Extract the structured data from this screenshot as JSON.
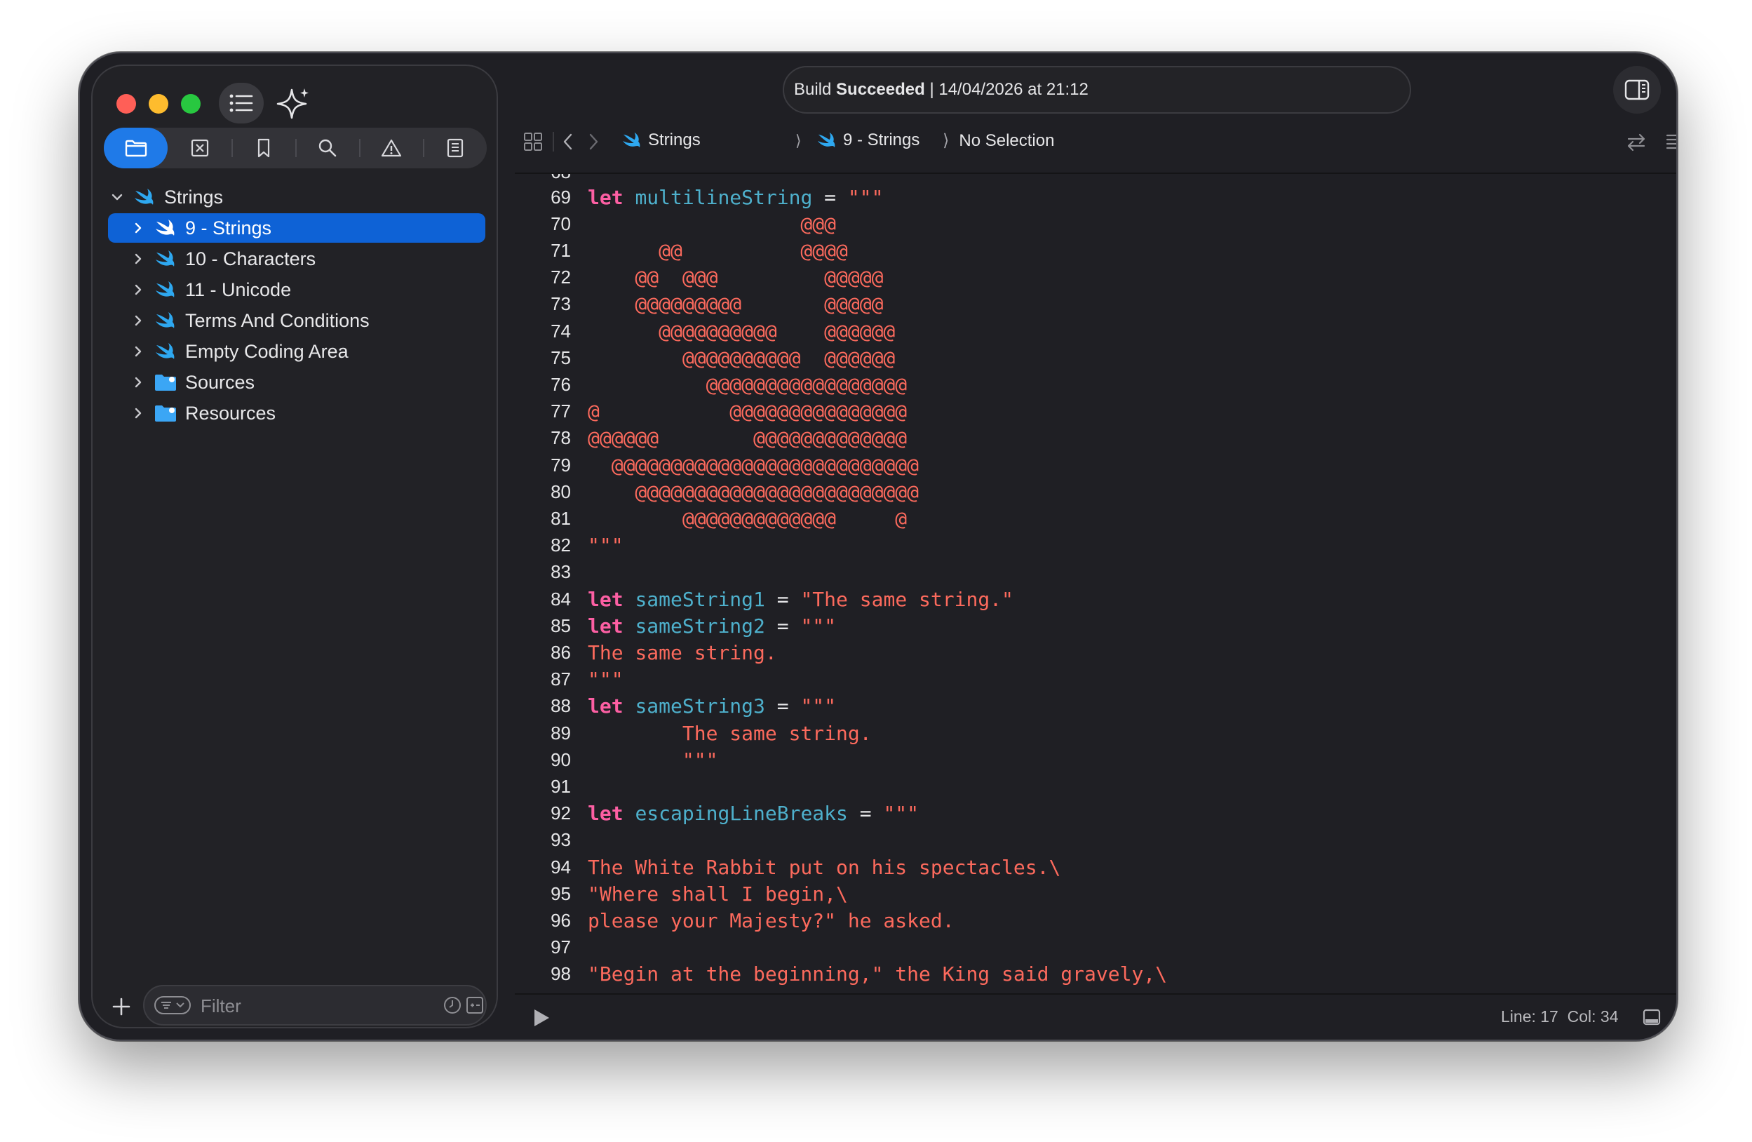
{
  "toolbar": {
    "build_prefix": "Build ",
    "build_state": "Succeeded",
    "build_time": " | 14/04/2026 at 21:12"
  },
  "navigator": {
    "tabs": [
      "folder-icon",
      "source-control-icon",
      "bookmark-icon",
      "search-icon",
      "warning-icon",
      "report-icon"
    ],
    "root": "Strings",
    "items": [
      {
        "label": "9 - Strings",
        "icon": "swift-icon",
        "selected": true
      },
      {
        "label": "10 - Characters",
        "icon": "swift-icon"
      },
      {
        "label": "11 - Unicode",
        "icon": "swift-icon"
      },
      {
        "label": "Terms And Conditions",
        "icon": "swift-icon"
      },
      {
        "label": "Empty Coding Area",
        "icon": "swift-icon"
      },
      {
        "label": "Sources",
        "icon": "folder-icon"
      },
      {
        "label": "Resources",
        "icon": "folder-icon"
      }
    ],
    "filter_placeholder": "Filter"
  },
  "jumpbar": {
    "crumb1": "Strings",
    "crumb2": "9 - Strings",
    "crumb3": "No Selection"
  },
  "code": {
    "lines": [
      {
        "n": "69",
        "t": [
          [
            "kw",
            "let"
          ],
          [
            "op",
            " "
          ],
          [
            "id",
            "multilineString"
          ],
          [
            "op",
            " = "
          ],
          [
            "str",
            "\"\"\""
          ]
        ]
      },
      {
        "n": "70",
        "t": [
          [
            "str",
            "                  @@@"
          ]
        ]
      },
      {
        "n": "71",
        "t": [
          [
            "str",
            "      @@          @@@@"
          ]
        ]
      },
      {
        "n": "72",
        "t": [
          [
            "str",
            "    @@  @@@         @@@@@"
          ]
        ]
      },
      {
        "n": "73",
        "t": [
          [
            "str",
            "    @@@@@@@@@       @@@@@"
          ]
        ]
      },
      {
        "n": "74",
        "t": [
          [
            "str",
            "      @@@@@@@@@@    @@@@@@"
          ]
        ]
      },
      {
        "n": "75",
        "t": [
          [
            "str",
            "        @@@@@@@@@@  @@@@@@"
          ]
        ]
      },
      {
        "n": "76",
        "t": [
          [
            "str",
            "          @@@@@@@@@@@@@@@@@"
          ]
        ]
      },
      {
        "n": "77",
        "t": [
          [
            "str",
            "@           @@@@@@@@@@@@@@@"
          ]
        ]
      },
      {
        "n": "78",
        "t": [
          [
            "str",
            "@@@@@@        @@@@@@@@@@@@@"
          ]
        ]
      },
      {
        "n": "79",
        "t": [
          [
            "str",
            "  @@@@@@@@@@@@@@@@@@@@@@@@@@"
          ]
        ]
      },
      {
        "n": "80",
        "t": [
          [
            "str",
            "    @@@@@@@@@@@@@@@@@@@@@@@@"
          ]
        ]
      },
      {
        "n": "81",
        "t": [
          [
            "str",
            "        @@@@@@@@@@@@@     @"
          ]
        ]
      },
      {
        "n": "82",
        "t": [
          [
            "str",
            "\"\"\""
          ]
        ]
      },
      {
        "n": "83",
        "t": []
      },
      {
        "n": "84",
        "t": [
          [
            "kw",
            "let"
          ],
          [
            "op",
            " "
          ],
          [
            "id",
            "sameString1"
          ],
          [
            "op",
            " = "
          ],
          [
            "str",
            "\"The same string.\""
          ]
        ]
      },
      {
        "n": "85",
        "t": [
          [
            "kw",
            "let"
          ],
          [
            "op",
            " "
          ],
          [
            "id",
            "sameString2"
          ],
          [
            "op",
            " = "
          ],
          [
            "str",
            "\"\"\""
          ]
        ]
      },
      {
        "n": "86",
        "t": [
          [
            "str",
            "The same string."
          ]
        ]
      },
      {
        "n": "87",
        "t": [
          [
            "str",
            "\"\"\""
          ]
        ]
      },
      {
        "n": "88",
        "t": [
          [
            "kw",
            "let"
          ],
          [
            "op",
            " "
          ],
          [
            "id",
            "sameString3"
          ],
          [
            "op",
            " = "
          ],
          [
            "str",
            "\"\"\""
          ]
        ]
      },
      {
        "n": "89",
        "t": [
          [
            "str",
            "        The same string."
          ]
        ]
      },
      {
        "n": "90",
        "t": [
          [
            "str",
            "        \"\"\""
          ]
        ]
      },
      {
        "n": "91",
        "t": []
      },
      {
        "n": "92",
        "t": [
          [
            "kw",
            "let"
          ],
          [
            "op",
            " "
          ],
          [
            "id",
            "escapingLineBreaks"
          ],
          [
            "op",
            " = "
          ],
          [
            "str",
            "\"\"\""
          ]
        ]
      },
      {
        "n": "93",
        "t": []
      },
      {
        "n": "94",
        "t": [
          [
            "str",
            "The White Rabbit put on his spectacles.\\"
          ]
        ]
      },
      {
        "n": "95",
        "t": [
          [
            "str",
            "\"Where shall I begin,\\"
          ]
        ]
      },
      {
        "n": "96",
        "t": [
          [
            "str",
            "please your Majesty?\" he asked."
          ]
        ]
      },
      {
        "n": "97",
        "t": []
      },
      {
        "n": "98",
        "t": [
          [
            "str",
            "\"Begin at the beginning,\" the King said gravely,\\"
          ]
        ]
      }
    ]
  },
  "status": {
    "line_col": "Line: 17  Col: 34"
  },
  "colors": {
    "keyword": "#fc5fa3",
    "identifier": "#4eb0cc",
    "string": "#fc6a5d",
    "selection": "#0e62d6",
    "accent": "#1f7ae8"
  }
}
